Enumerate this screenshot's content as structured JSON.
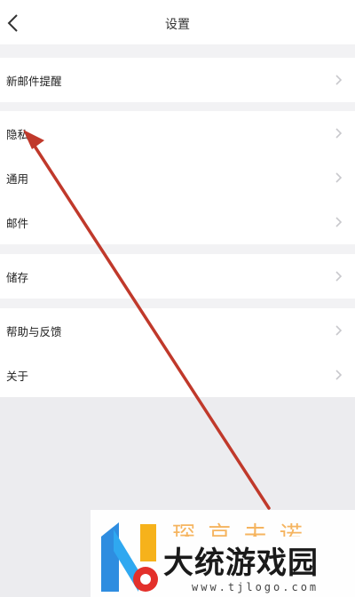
{
  "header": {
    "title": "设置",
    "back_icon": "chevron-left-icon"
  },
  "groups": [
    {
      "items": [
        {
          "label": "新邮件提醒"
        }
      ]
    },
    {
      "items": [
        {
          "label": "隐私"
        },
        {
          "label": "通用"
        },
        {
          "label": "邮件"
        }
      ]
    },
    {
      "items": [
        {
          "label": "储存"
        }
      ]
    },
    {
      "items": [
        {
          "label": "帮助与反馈"
        },
        {
          "label": "关于"
        }
      ]
    }
  ],
  "row_icon": "chevron-right-icon",
  "annotation": {
    "type": "arrow",
    "color": "#c0392b",
    "points_to": "隐私"
  },
  "watermark": {
    "brand_top": "琛 京 夫 诺",
    "brand": "大统游戏园",
    "url": "www.tjlogo.com"
  },
  "colors": {
    "background": "#f2f2f4",
    "row_bg": "#ffffff",
    "text": "#222222",
    "chevron": "#c8c8cc",
    "arrow": "#c0392b"
  }
}
